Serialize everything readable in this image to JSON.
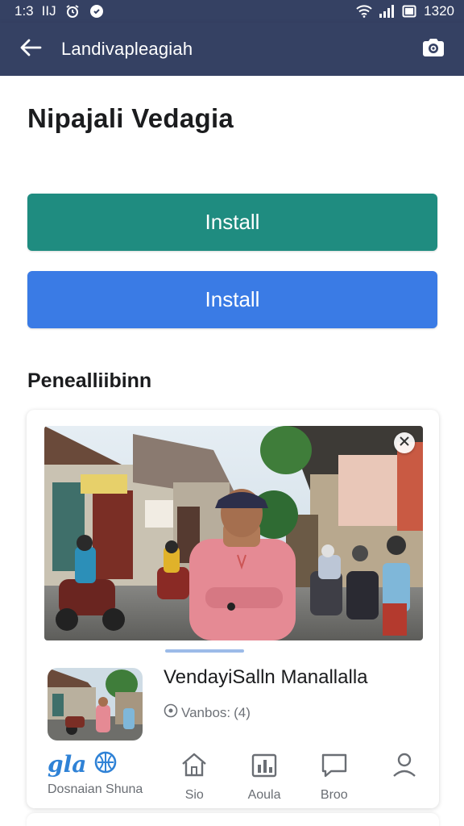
{
  "status_bar": {
    "time": "1:3",
    "left_label": "IIJ",
    "right_time": "1320",
    "icons": [
      "alarm-icon",
      "shield-badge-icon",
      "wifi-icon",
      "signal-icon",
      "battery-icon"
    ]
  },
  "app_bar": {
    "title": "Landivapleagiah",
    "back_icon": "arrow-left-icon",
    "action_icon": "camera-icon"
  },
  "page": {
    "title": "Nipajali Vedagia"
  },
  "buttons": {
    "install_primary": "Install",
    "install_secondary": "Install"
  },
  "section": {
    "title": "Penealliibinn"
  },
  "card": {
    "close_icon": "close-icon",
    "app_name": "VendayiSalln Manallalla",
    "meta_label": "Vanbos:",
    "meta_value": "(4)"
  },
  "bottom_nav": {
    "items": [
      {
        "label": "Dosnaian Shuna",
        "brand": "gla",
        "icon": "brand-logo-icon"
      },
      {
        "label": "Sio",
        "icon": "home-icon"
      },
      {
        "label": "Aoula",
        "icon": "chart-icon"
      },
      {
        "label": "Broo",
        "icon": "chat-icon"
      },
      {
        "label": "",
        "icon": "profile-icon"
      }
    ]
  },
  "colors": {
    "app_bar": "#354163",
    "teal_button": "#1f8c80",
    "blue_button": "#3a7be5",
    "brand_blue": "#2f82d6"
  }
}
